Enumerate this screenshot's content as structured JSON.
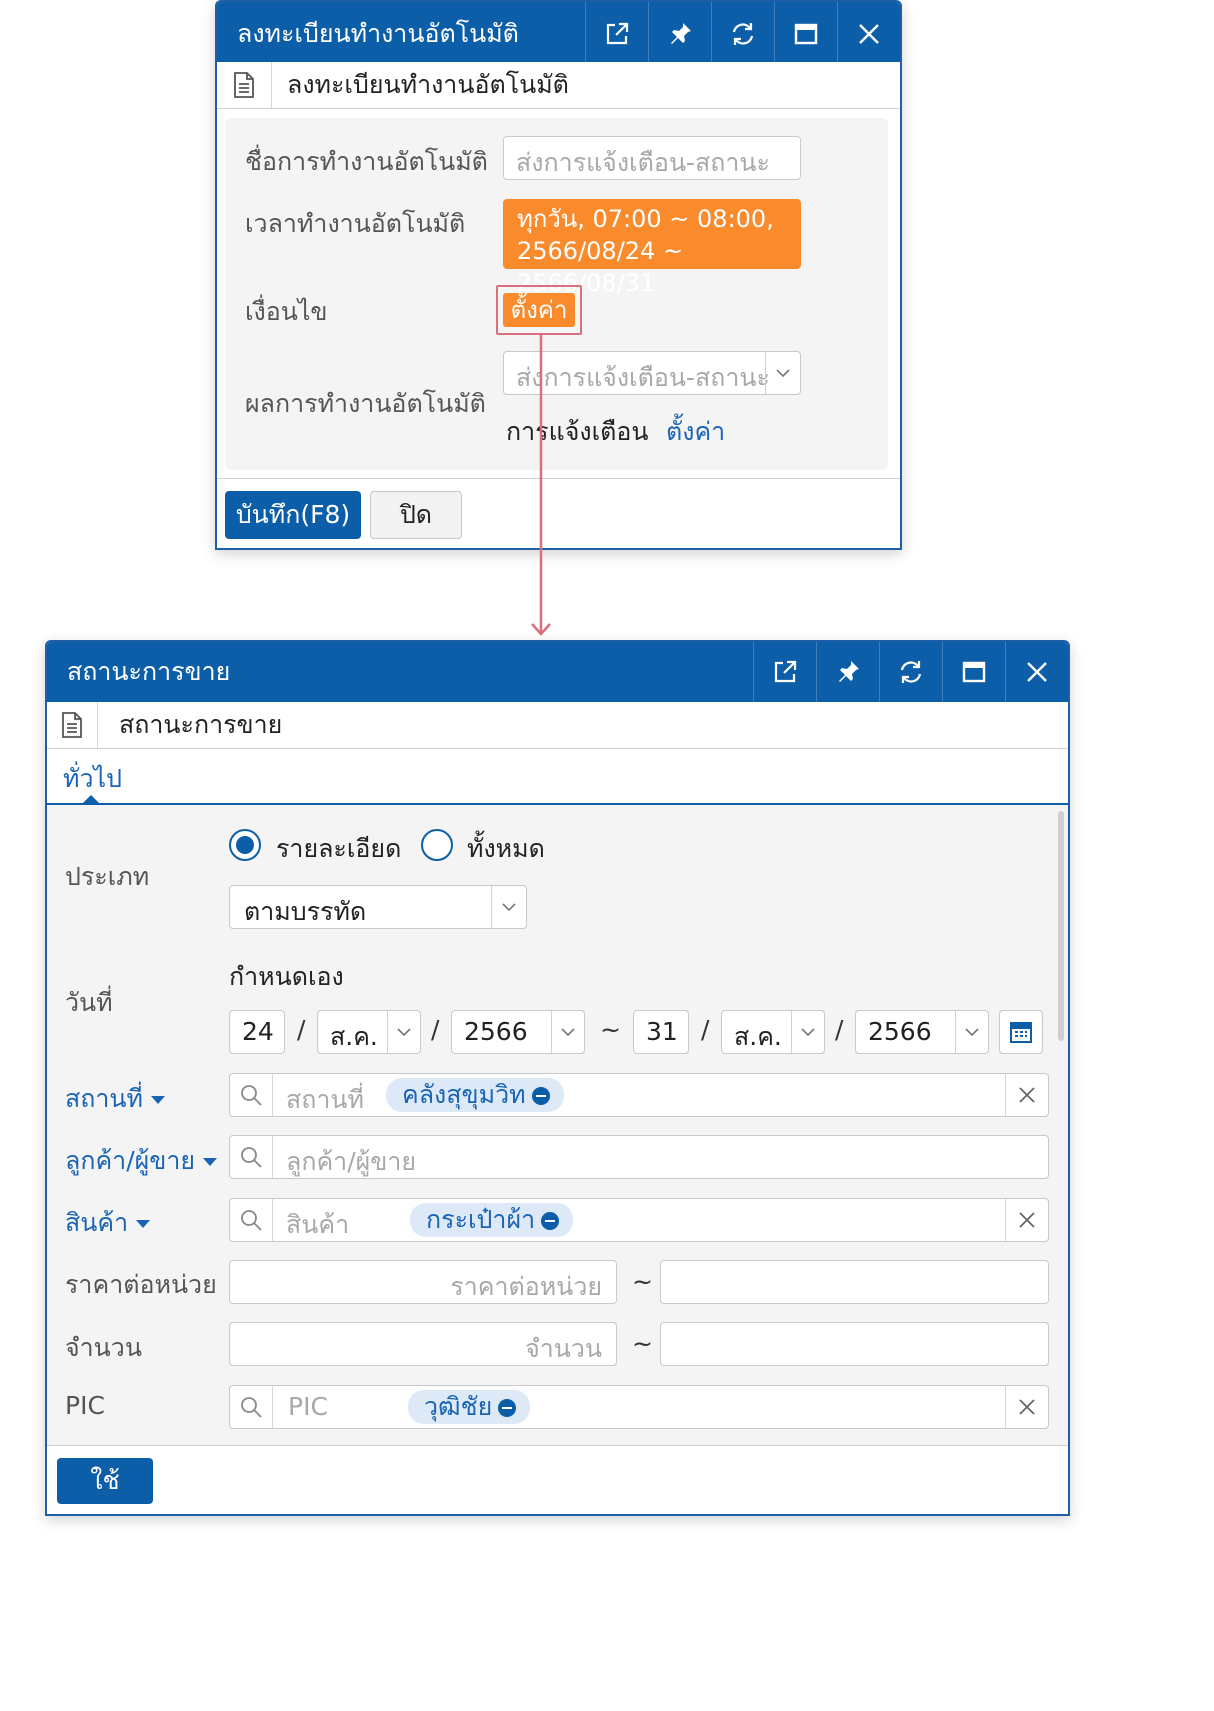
{
  "colors": {
    "primary": "#0d5ea8",
    "accent_orange": "#f98b2d",
    "highlight_border": "#d9707e",
    "link": "#1b64b5",
    "panel_bg": "#f4f4f4"
  },
  "dialog1": {
    "title": "ลงทะเบียนทำงานอัตโนมัติ",
    "subheader": "ลงทะเบียนทำงานอัตโนมัติ",
    "fields": {
      "name_label": "ชื่อการทำงานอัตโนมัติ",
      "name_placeholder": "ส่งการแจ้งเตือน-สถานะ",
      "time_label": "เวลาทำงานอัตโนมัติ",
      "schedule_line1": "ทุกวัน, 07:00 ~ 08:00,",
      "schedule_line2": "2566/08/24 ~ 2566/08/31",
      "condition_label": "เงื่อนไข",
      "condition_button": "ตั้งค่า",
      "result_label": "ผลการทำงานอัตโนมัติ",
      "result_select_value": "ส่งการแจ้งเตือน-สถานะ",
      "notify_label": "การแจ้งเตือน",
      "notify_link": "ตั้งค่า"
    },
    "footer": {
      "save": "บันทึก(F8)",
      "close": "ปิด"
    }
  },
  "dialog2": {
    "title": "สถานะการขาย",
    "subheader": "สถานะการขาย",
    "tab": "ทั่วไป",
    "type": {
      "label": "ประเภท",
      "option_detail": "รายละเอียด",
      "option_all": "ทั้งหมด",
      "selected": "option_detail",
      "select_value": "ตามบรรทัด"
    },
    "date": {
      "label": "วันที่",
      "mode": "กำหนดเอง",
      "from_day": "24",
      "from_month": "ส.ค.",
      "from_year": "2566",
      "to_day": "31",
      "to_month": "ส.ค.",
      "to_year": "2566",
      "slash": "/",
      "tilde": "~"
    },
    "location": {
      "label": "สถานที่",
      "placeholder": "สถานที่",
      "tag": "คลังสุขุมวิท"
    },
    "customer": {
      "label": "ลูกค้า/ผู้ขาย",
      "placeholder": "ลูกค้า/ผู้ขาย"
    },
    "product": {
      "label": "สินค้า",
      "placeholder": "สินค้า",
      "tag": "กระเป๋าผ้า"
    },
    "unit_price": {
      "label": "ราคาต่อหน่วย",
      "placeholder": "ราคาต่อหน่วย",
      "tilde": "~"
    },
    "quantity": {
      "label": "จำนวน",
      "placeholder": "จำนวน",
      "tilde": "~"
    },
    "pic": {
      "label": "PIC",
      "placeholder": "PIC",
      "tag": "วุฒิชัย"
    },
    "apply": "ใช้"
  }
}
